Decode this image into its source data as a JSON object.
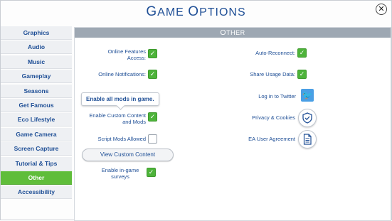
{
  "window": {
    "title_initial_1": "G",
    "title_rest_1": "AME ",
    "title_initial_2": "O",
    "title_rest_2": "PTIONS",
    "close_icon": "close-x-icon"
  },
  "sidebar": {
    "items": [
      {
        "label": "Graphics"
      },
      {
        "label": "Audio"
      },
      {
        "label": "Music"
      },
      {
        "label": "Gameplay"
      },
      {
        "label": "Seasons"
      },
      {
        "label": "Get Famous"
      },
      {
        "label": "Eco Lifestyle"
      },
      {
        "label": "Game Camera"
      },
      {
        "label": "Screen Capture"
      },
      {
        "label": "Tutorial & Tips"
      },
      {
        "label": "Other"
      },
      {
        "label": "Accessibility"
      }
    ],
    "active_index": 10
  },
  "panel": {
    "header_initial": "O",
    "header_rest": "THER",
    "left": {
      "online_features": "Online Features Access:",
      "online_notifications": "Online Notifications:",
      "tooltip": "Enable all mods in game.",
      "enable_custom": "Enable Custom Content and Mods",
      "script_mods": "Script Mods Allowed",
      "view_custom_button": "View Custom Content",
      "ingame_surveys": "Enable in-game surveys"
    },
    "right": {
      "auto_reconnect": "Auto-Reconnect:",
      "share_usage": "Share Usage Data:",
      "twitter": "Log in to Twitter",
      "privacy": "Privacy & Cookies",
      "ea_agreement": "EA User Agreement"
    }
  },
  "colors": {
    "accent_green": "#5fbd3a",
    "text_blue": "#1f4f96",
    "header_gray": "#9ea8b3",
    "twitter_blue": "#4a9fe5"
  }
}
